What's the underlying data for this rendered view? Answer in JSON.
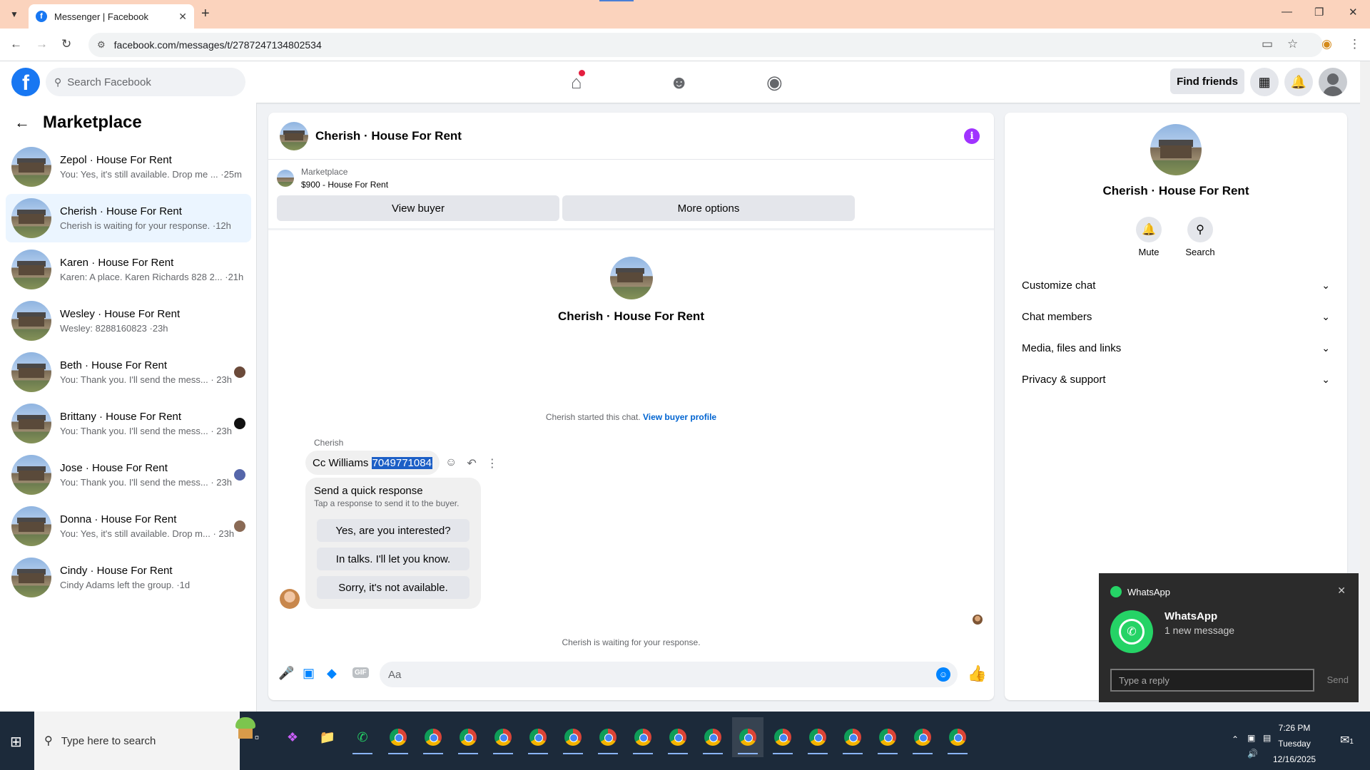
{
  "browser": {
    "tab_title": "Messenger | Facebook",
    "url": "facebook.com/messages/t/2787247134802534"
  },
  "fb_header": {
    "search_placeholder": "Search Facebook",
    "find_friends": "Find friends"
  },
  "sidebar": {
    "title": "Marketplace",
    "conversations": [
      {
        "name": "Zepol · House For Rent",
        "preview": "You: Yes, it's still available. Drop me ... ·25m",
        "seen_color": ""
      },
      {
        "name": "Cherish · House For Rent",
        "preview": "Cherish is waiting for your response. ·12h",
        "seen_color": ""
      },
      {
        "name": "Karen · House For Rent",
        "preview": "Karen: A place. Karen Richards 828 2... ·21h",
        "seen_color": ""
      },
      {
        "name": "Wesley · House For Rent",
        "preview": "Wesley: 8288160823 ·23h",
        "seen_color": ""
      },
      {
        "name": "Beth · House For Rent",
        "preview": "You: Thank you. I'll send the mess... · 23h",
        "seen_color": "#6b4a3a"
      },
      {
        "name": "Brittany · House For Rent",
        "preview": "You: Thank you. I'll send the mess... · 23h",
        "seen_color": "#111111"
      },
      {
        "name": "Jose · House For Rent",
        "preview": "You: Thank you. I'll send the mess... · 23h",
        "seen_color": "#5566aa"
      },
      {
        "name": "Donna · House For Rent",
        "preview": "You: Yes, it's still available. Drop m... · 23h",
        "seen_color": "#8a6a55"
      },
      {
        "name": "Cindy · House For Rent",
        "preview": "Cindy Adams left the group. ·1d",
        "seen_color": ""
      }
    ]
  },
  "chat": {
    "title": "Cherish · House For Rent",
    "marketplace_label": "Marketplace",
    "listing": "$900 - House For Rent",
    "view_buyer": "View buyer",
    "more_options": "More options",
    "center_name": "Cherish · House For Rent",
    "started_text": "Cherish started this chat.",
    "view_buyer_profile": "View buyer profile",
    "sender": "Cherish",
    "message_prefix": "Cc Williams",
    "message_selected": "7049771084",
    "quick_title": "Send a quick response",
    "quick_sub": "Tap a response to send it to the buyer.",
    "quick_responses": [
      "Yes, are you interested?",
      "In talks. I'll let you know.",
      "Sorry, it's not available."
    ],
    "waiting": "Cherish is waiting for your response.",
    "composer_placeholder": "Aa"
  },
  "right_panel": {
    "name": "Cherish · House For Rent",
    "mute": "Mute",
    "search": "Search",
    "rows": [
      "Customize chat",
      "Chat members",
      "Media, files and links",
      "Privacy & support"
    ]
  },
  "toast": {
    "app": "WhatsApp",
    "title": "WhatsApp",
    "subtitle": "1 new message",
    "reply_placeholder": "Type a reply",
    "send": "Send"
  },
  "taskbar": {
    "search_placeholder": "Type here to search",
    "time": "7:26 PM",
    "day": "Tuesday",
    "date": "12/16/2025",
    "notif_count": "1"
  },
  "colors": {
    "brand": "#1877f2",
    "messenger_blue": "#0084ff",
    "whatsapp": "#25d366"
  }
}
